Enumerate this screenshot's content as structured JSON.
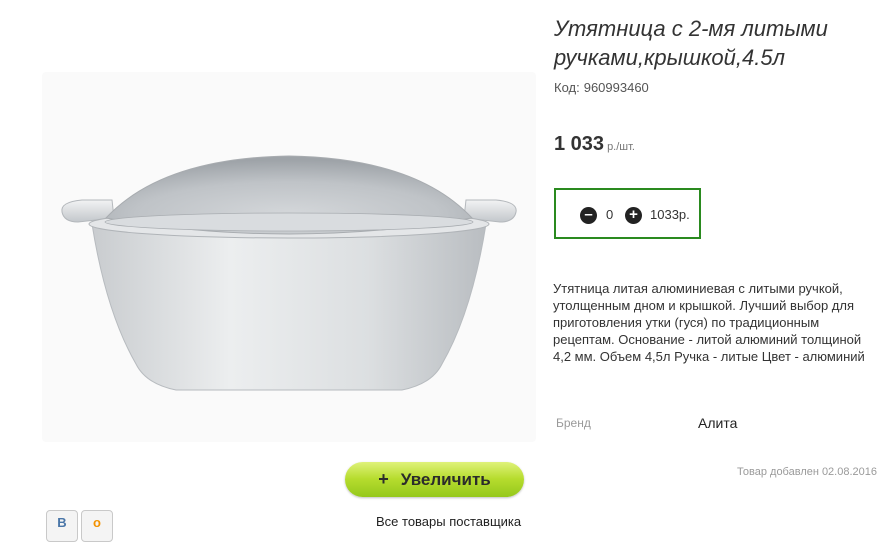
{
  "product": {
    "title": "Утятница с 2-мя литыми ручками,крышкой,4.5л",
    "code_label": "Код:",
    "code_value": "960993460",
    "price_value": "1 033",
    "price_unit": "р./шт.",
    "description": "Утятница литая алюминиевая с литыми ручкой, утолщенным дном и крышкой. Лучший выбор для приготовления утки (гуся) по традиционным рецептам. Основание - литой алюминий толщиной 4,2 мм. Объем 4,5л Ручка - литые Цвет - алюминий"
  },
  "quantity": {
    "minus_icon": "minus-circle-icon",
    "plus_icon": "plus-circle-icon",
    "value": "0",
    "total": "1033р."
  },
  "brand": {
    "label": "Бренд",
    "value": "Алита"
  },
  "added": {
    "label": "Товар добавлен",
    "date": "02.08.2016"
  },
  "zoom": {
    "icon": "plus-icon",
    "label": "Увеличить"
  },
  "share": {
    "vk": "В",
    "ok": "о"
  },
  "supplier_link": "Все товары поставщика",
  "colors": {
    "qty_border": "#2a8a1f",
    "zoom_button": "#b6dc2e"
  }
}
